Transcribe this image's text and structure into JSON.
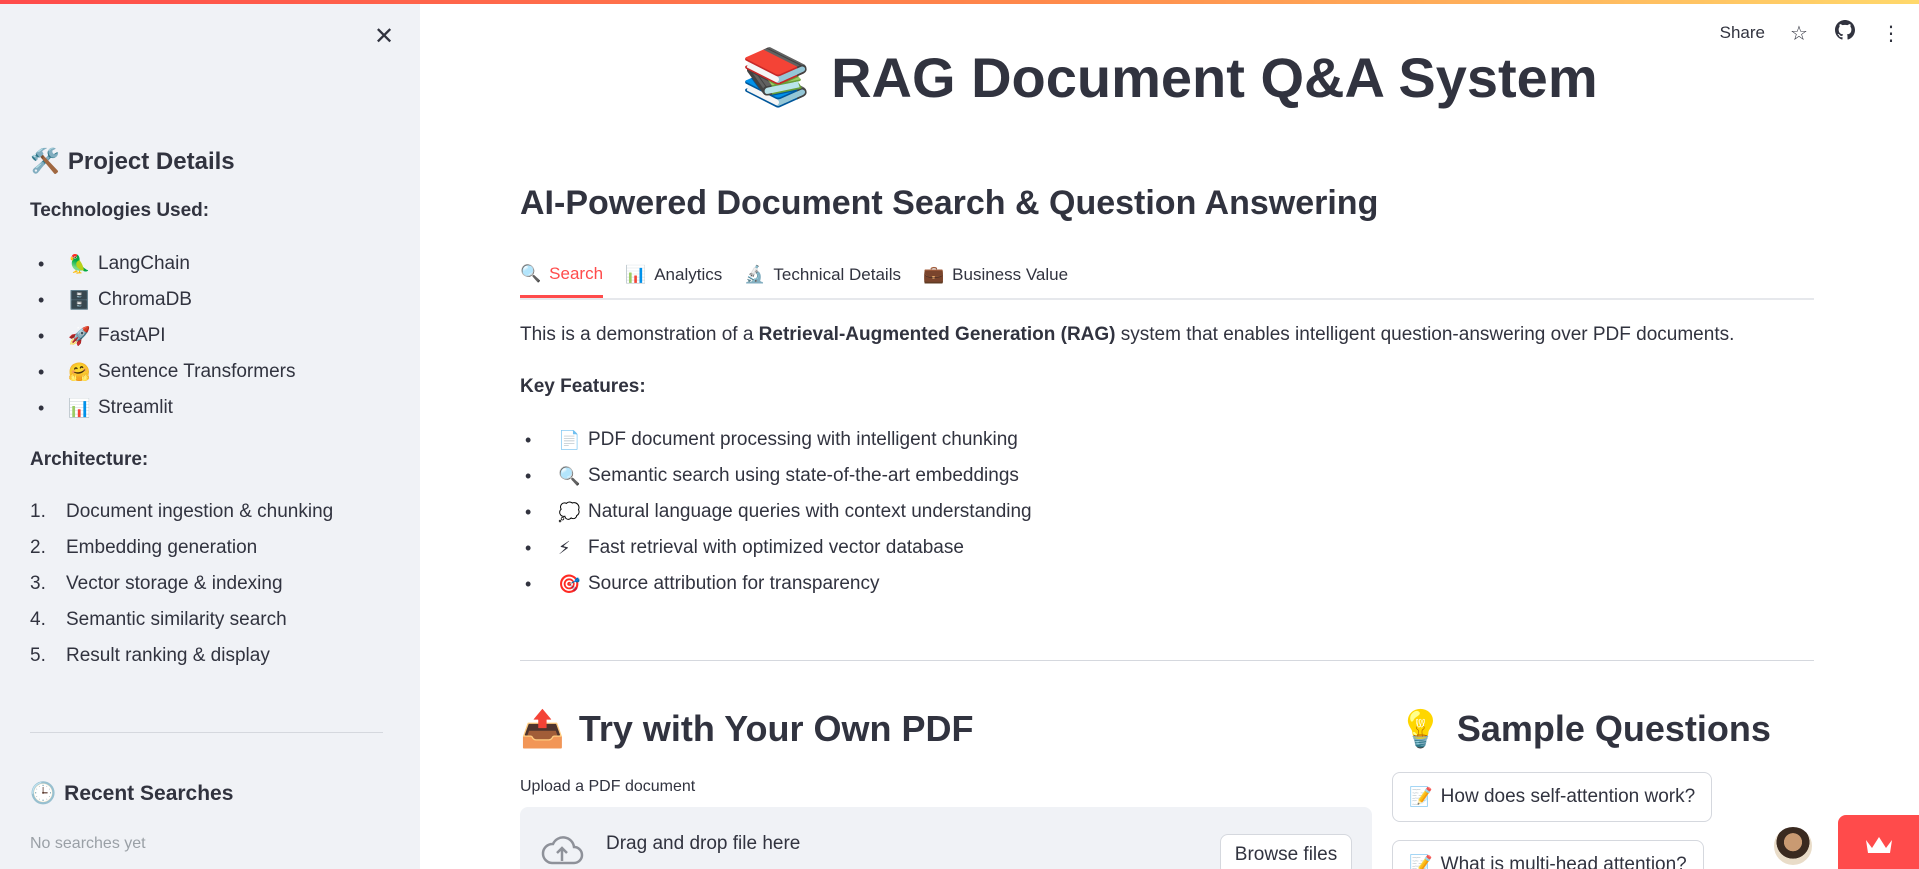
{
  "sidebar": {
    "close_icon": "close-icon",
    "project_title": "Project Details",
    "project_icon": "🛠️",
    "technologies_label": "Technologies Used:",
    "technologies": [
      {
        "icon": "🦜",
        "label": "LangChain"
      },
      {
        "icon": "🗄️",
        "label": "ChromaDB"
      },
      {
        "icon": "🚀",
        "label": "FastAPI"
      },
      {
        "icon": "🤗",
        "label": "Sentence Transformers"
      },
      {
        "icon": "📊",
        "label": "Streamlit"
      }
    ],
    "architecture_label": "Architecture:",
    "architecture": [
      {
        "num": "1.",
        "label": "Document ingestion & chunking"
      },
      {
        "num": "2.",
        "label": "Embedding generation"
      },
      {
        "num": "3.",
        "label": "Vector storage & indexing"
      },
      {
        "num": "4.",
        "label": "Semantic similarity search"
      },
      {
        "num": "5.",
        "label": "Result ranking & display"
      }
    ],
    "recent_title": "Recent Searches",
    "recent_icon": "🕒",
    "recent_empty": "No searches yet"
  },
  "toolbar": {
    "share_label": "Share",
    "star_icon": "☆",
    "github_icon": "github-icon",
    "menu_icon": "⋮"
  },
  "main": {
    "title": "RAG Document Q&A System",
    "title_icon": "📚",
    "subheader": "AI-Powered Document Search & Question Answering",
    "tabs": [
      {
        "icon": "🔍",
        "label": "Search"
      },
      {
        "icon": "📊",
        "label": "Analytics"
      },
      {
        "icon": "🔬",
        "label": "Technical Details"
      },
      {
        "icon": "💼",
        "label": "Business Value"
      }
    ],
    "intro_before": "This is a demonstration of a ",
    "intro_bold": "Retrieval-Augmented Generation (RAG)",
    "intro_after": " system that enables intelligent question-answering over PDF documents.",
    "key_features_label": "Key Features:",
    "features": [
      {
        "icon": "📄",
        "label": "PDF document processing with intelligent chunking"
      },
      {
        "icon": "🔍",
        "label": "Semantic search using state-of-the-art embeddings"
      },
      {
        "icon": "💭",
        "label": "Natural language queries with context understanding"
      },
      {
        "icon": "⚡",
        "label": "Fast retrieval with optimized vector database"
      },
      {
        "icon": "🎯",
        "label": "Source attribution for transparency"
      }
    ],
    "upload_title": "Try with Your Own PDF",
    "upload_icon": "📤",
    "upload_label": "Upload a PDF document",
    "dropzone_text": "Drag and drop file here",
    "browse_label": "Browse files",
    "sample_title": "Sample Questions",
    "sample_icon": "💡",
    "sample_questions": [
      {
        "icon": "📝",
        "label": "How does self-attention work?"
      },
      {
        "icon": "📝",
        "label": "What is multi-head attention?"
      }
    ]
  },
  "colors": {
    "accent": "#ff4b4b",
    "sidebar_bg": "#f0f2f6",
    "text": "#31333f"
  }
}
